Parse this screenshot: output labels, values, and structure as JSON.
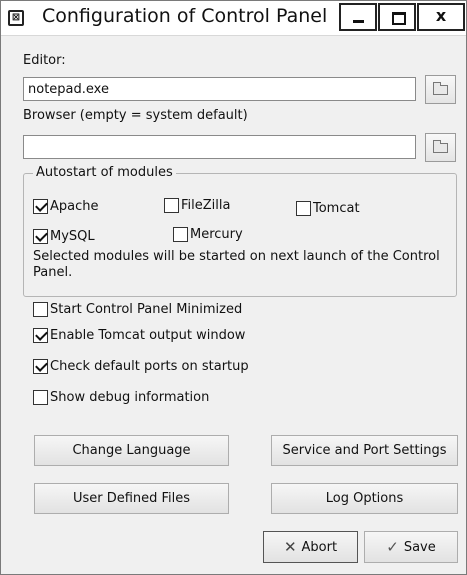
{
  "window": {
    "title": "Configuration of Control Panel",
    "controls": {
      "minimize": "",
      "maximize": "",
      "close": "x"
    }
  },
  "editor": {
    "label": "Editor:",
    "value": "notepad.exe"
  },
  "browser": {
    "label": "Browser (empty = system default)",
    "value": ""
  },
  "autostart": {
    "legend": "Autostart of modules",
    "modules": [
      {
        "label": "Apache",
        "checked": true
      },
      {
        "label": "FileZilla",
        "checked": false
      },
      {
        "label": "Tomcat",
        "checked": false
      },
      {
        "label": "MySQL",
        "checked": true
      },
      {
        "label": "Mercury",
        "checked": false
      }
    ],
    "info": "Selected modules will be started on next launch of the Control Panel."
  },
  "options": [
    {
      "label": "Start Control Panel Minimized",
      "checked": false
    },
    {
      "label": "Enable Tomcat output window",
      "checked": true
    },
    {
      "label": "Check default ports on startup",
      "checked": true
    },
    {
      "label": "Show debug information",
      "checked": false
    }
  ],
  "buttons": {
    "change_language": "Change Language",
    "service_port_settings": "Service and Port Settings",
    "user_defined_files": "User Defined Files",
    "log_options": "Log Options",
    "abort": "Abort",
    "save": "Save"
  },
  "icons": {
    "app": "xampp-icon",
    "browse": "folder-icon",
    "abort": "cross-icon",
    "save": "checkmark-icon"
  }
}
